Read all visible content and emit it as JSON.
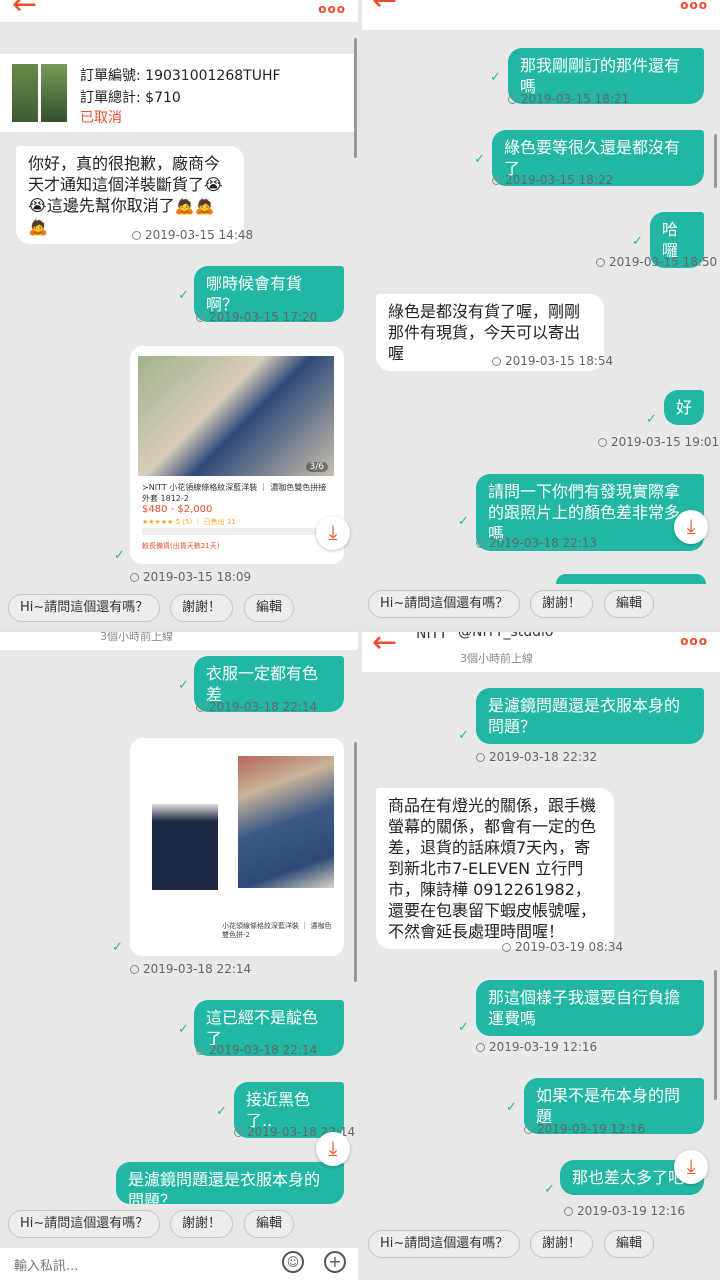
{
  "order": {
    "number_label": "訂單編號: 19031001268TUHF",
    "total_label": "訂單總計: $710",
    "status": "已取消"
  },
  "product": {
    "title": "≻NITT 小花領線條格紋深藍洋裝 ｜ 濃咖色雙色拼接外套 1812-2",
    "price": "$480 - $2,000",
    "rating": "★★★★★ 5 (5) ｜ 已售出 11",
    "shipping": "較長備貨(出貨天數21天)",
    "page_indicator": "3/6"
  },
  "product2": {
    "caption": "小花領線條格紋深藍洋裝 ｜ 濃咖色雙色拼-2"
  },
  "shop": {
    "status": "3個小時前上線",
    "name": "@NITT_studio",
    "logo_text": "NITT"
  },
  "quick": {
    "q1": "Hi~請問這個還有嗎？",
    "q2": "謝謝！",
    "q3": "編輯"
  },
  "input": {
    "placeholder": "輸入私訊..."
  },
  "p1": {
    "m1": "你好，真的很抱歉，廠商今天才通知這個洋裝斷貨了😭😭這邊先幫你取消了🙇🙇🙇",
    "t1": "2019-03-15 14:48",
    "m2": "哪時候會有貨啊？",
    "t2": "2019-03-15 17:20",
    "t3": "2019-03-15 18:09"
  },
  "p2": {
    "m1": "那我剛剛訂的那件還有嗎",
    "t1": "2019-03-15 18:21",
    "m2": "綠色要等很久還是都沒有了",
    "t2": "2019-03-15 18:22",
    "m3": "哈囉",
    "t3": "2019-03-15 18:50",
    "m4": "綠色是都沒有貨了喔，剛剛那件有現貨，今天可以寄出喔",
    "t4": "2019-03-15 18:54",
    "m5": "好",
    "t5": "2019-03-15 19:01",
    "m6": "請問一下你們有發現實際拿的跟照片上的顏色差非常多嗎",
    "t6": "2019-03-18 22:13"
  },
  "p3": {
    "m1": "衣服一定都有色差",
    "t1": "2019-03-18 22:14",
    "t2": "2019-03-18 22:14",
    "m3": "這已經不是靛色了",
    "t3": "2019-03-18 22:14",
    "m4": "接近黑色了..",
    "t4": "2019-03-18 22:14",
    "m5": "是濾鏡問題還是衣服本身的問題？"
  },
  "p4": {
    "m1": "是濾鏡問題還是衣服本身的問題？",
    "t1": "2019-03-18 22:32",
    "m2": "商品在有燈光的關係，跟手機螢幕的關係，都會有一定的色差，退貨的話麻煩7天內，寄到新北市7-ELEVEN 立行門市，陳詩樺 0912261982，還要在包裹留下蝦皮帳號喔，不然會延長處理時間喔！",
    "t2": "2019-03-19 08:34",
    "m3": "那這個樣子我還要自行負擔運費嗎",
    "t3": "2019-03-19 12:16",
    "m4": "如果不是布本身的問題",
    "t4": "2019-03-19 12:16",
    "m5": "那也差太多了吧",
    "t5": "2019-03-19 12:16"
  },
  "colors": {
    "accent": "#ee4d2d",
    "bubble_out": "#22b7a4"
  }
}
